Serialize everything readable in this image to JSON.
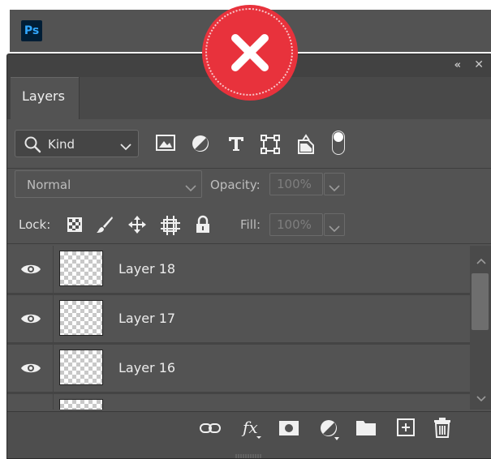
{
  "app": {
    "logo_text": "Ps",
    "accent": "#31a8ff"
  },
  "panel": {
    "collapse_glyph": "«",
    "close_glyph": "✕",
    "tab_label": "Layers"
  },
  "filter": {
    "kind_label": "Kind",
    "icons": [
      "image-filter-icon",
      "adjustment-filter-icon",
      "type-filter-icon",
      "shape-filter-icon",
      "smart-object-filter-icon",
      "filter-toggle"
    ]
  },
  "blend": {
    "mode": "Normal",
    "opacity_label": "Opacity:",
    "opacity_value": "100%",
    "fill_label": "Fill:",
    "fill_value": "100%"
  },
  "lock": {
    "label": "Lock:",
    "icons": [
      "lock-transparent-pixels-icon",
      "lock-image-pixels-icon",
      "lock-position-icon",
      "lock-artboard-icon",
      "lock-all-icon"
    ]
  },
  "layers": [
    {
      "name": "Layer 18",
      "visible": true
    },
    {
      "name": "Layer 17",
      "visible": true
    },
    {
      "name": "Layer 16",
      "visible": true
    },
    {
      "name": "",
      "visible": true
    }
  ],
  "footer": {
    "icons": [
      "link-layers-icon",
      "fx-icon",
      "layer-mask-icon",
      "new-adjustment-icon",
      "new-group-icon",
      "new-layer-icon",
      "delete-layer-icon"
    ],
    "fx_text": "fx"
  },
  "overlay": {
    "type": "error-badge",
    "color": "#e8323c"
  }
}
